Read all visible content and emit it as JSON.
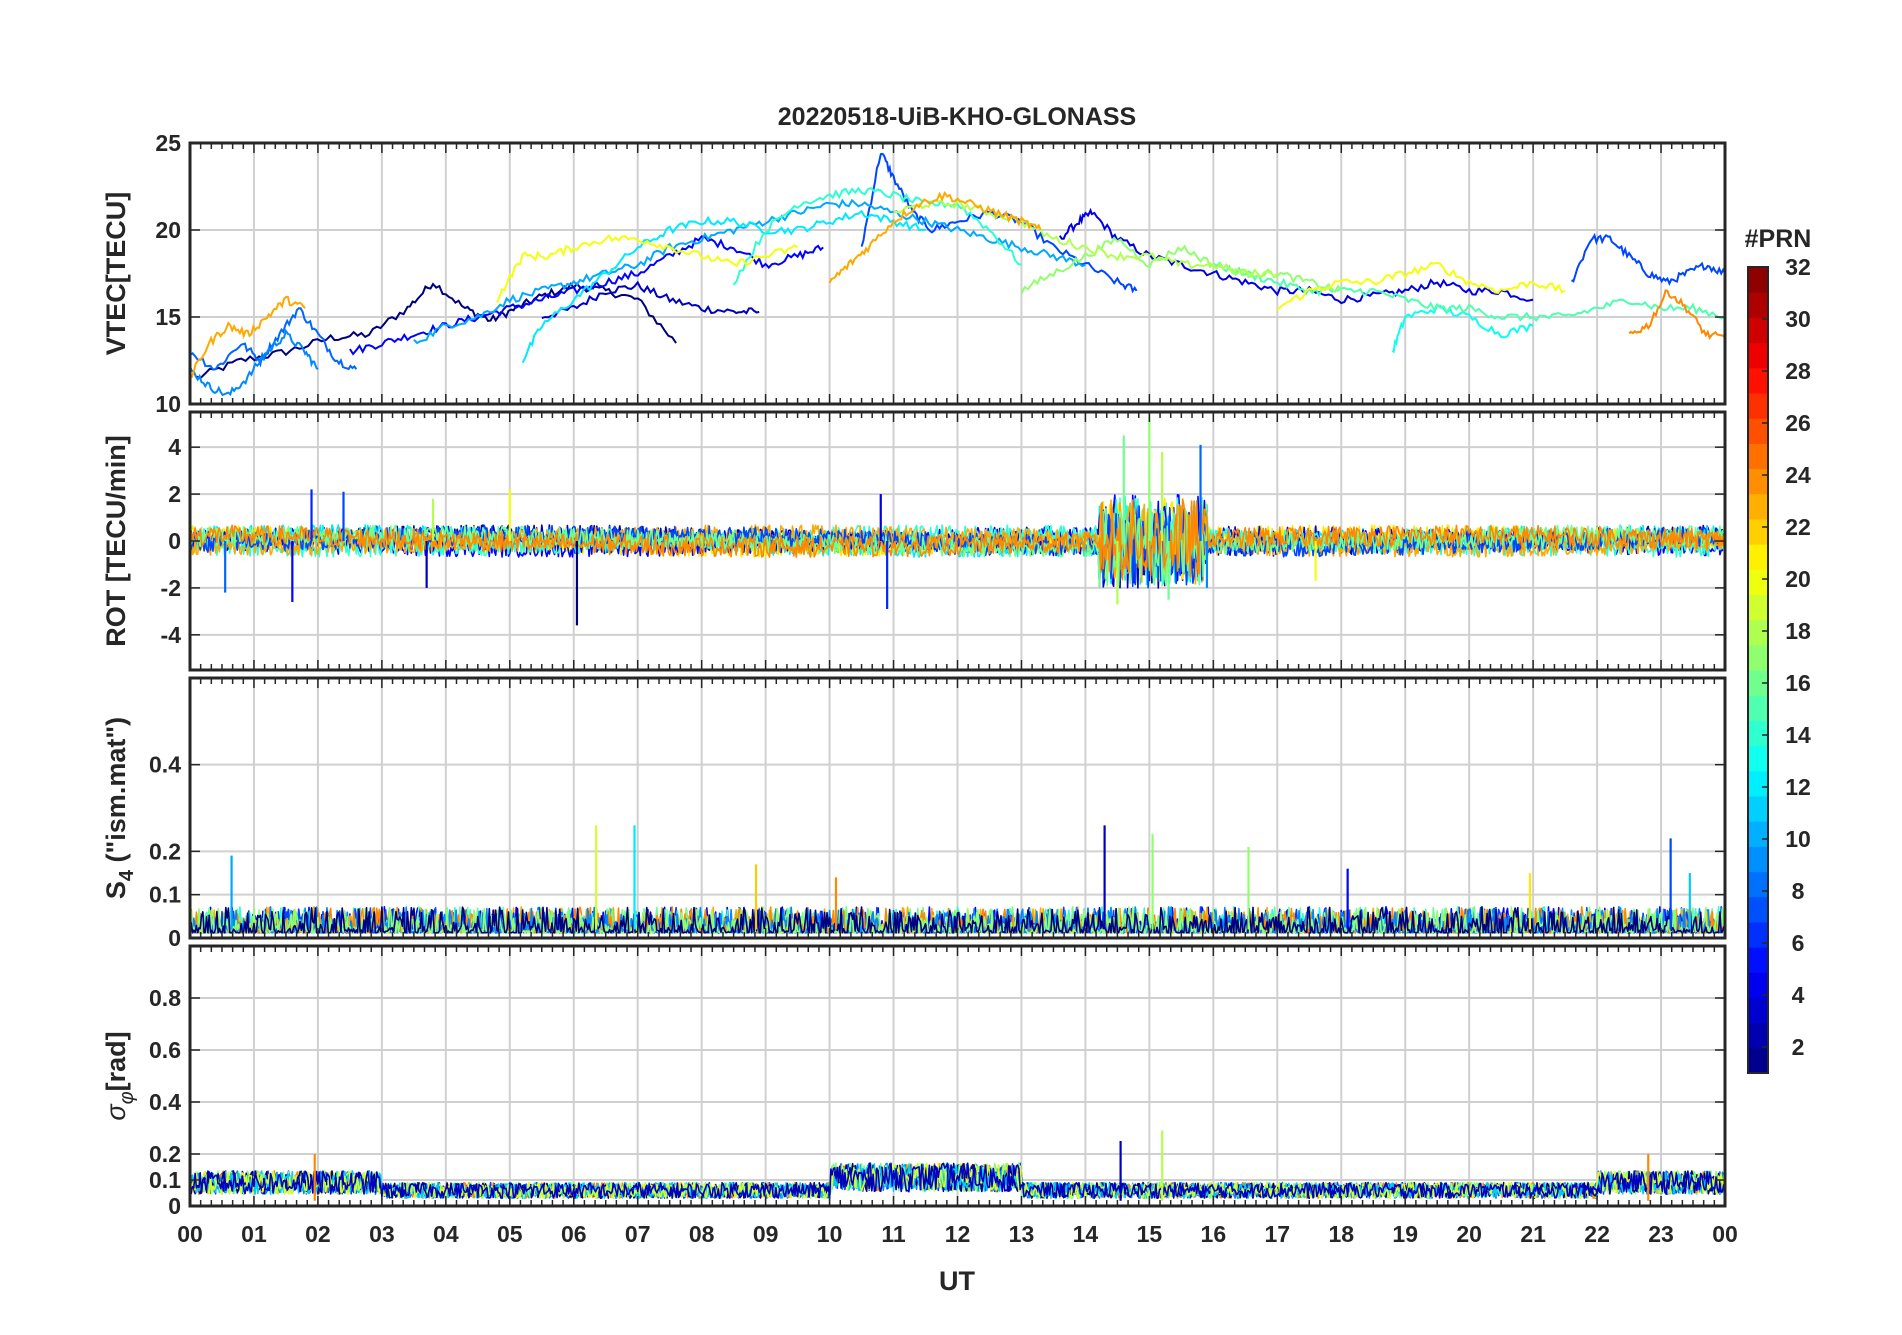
{
  "chart_data": {
    "type": "line",
    "title": "20220518-UiB-KHO-GLONASS",
    "xlabel": "UT",
    "x_tick_labels": [
      "00",
      "01",
      "02",
      "03",
      "04",
      "05",
      "06",
      "07",
      "08",
      "09",
      "10",
      "11",
      "12",
      "13",
      "14",
      "15",
      "16",
      "17",
      "18",
      "19",
      "20",
      "21",
      "22",
      "23",
      "00"
    ],
    "xlim": [
      0,
      24
    ],
    "grid": true,
    "colorbar": {
      "title": "#PRN",
      "range": [
        1,
        32
      ],
      "tick_labels": [
        "2",
        "4",
        "6",
        "8",
        "10",
        "12",
        "14",
        "16",
        "18",
        "20",
        "22",
        "24",
        "26",
        "28",
        "30",
        "32"
      ],
      "colormap": "jet"
    },
    "panels": [
      {
        "id": "vtec",
        "ylabel": "VTEC[TECU]",
        "ylim": [
          10,
          25
        ],
        "y_ticks": [
          10,
          15,
          20,
          25
        ],
        "y_tick_labels": [
          "10",
          "15",
          "20",
          "25"
        ],
        "series": [
          {
            "prn": 1,
            "x": [
              0.1,
              0.8,
              1.5,
              2.2,
              2.8,
              3.4,
              3.8,
              4.3,
              4.7,
              5.1,
              5.5,
              6.0,
              6.5,
              7.0,
              7.6
            ],
            "y": [
              11.5,
              12.5,
              13.0,
              13.8,
              14.0,
              15.5,
              17.0,
              15.5,
              14.8,
              15.5,
              16.2,
              16.8,
              16.5,
              16.0,
              13.5
            ]
          },
          {
            "prn": 3,
            "x": [
              5.5,
              6.0,
              6.5,
              7.0,
              7.5,
              8.0,
              8.5,
              8.9
            ],
            "y": [
              15.0,
              15.5,
              16.5,
              16.8,
              16.0,
              15.5,
              15.3,
              15.3
            ]
          },
          {
            "prn": 4,
            "x": [
              13.6,
              13.9,
              14.1,
              14.5,
              15.0,
              15.5,
              16.0,
              16.5,
              17.0,
              17.5,
              18.0,
              18.5,
              19.0,
              19.5,
              20.0,
              20.5,
              21.0
            ],
            "y": [
              19.5,
              20.5,
              21.0,
              19.5,
              18.5,
              18.0,
              17.5,
              17.0,
              16.5,
              16.5,
              16.0,
              16.2,
              16.5,
              17.0,
              16.5,
              16.5,
              16.0
            ]
          },
          {
            "prn": 5,
            "x": [
              2.5,
              3.0,
              3.5,
              4.0,
              4.5,
              5.0,
              5.5,
              6.0,
              6.5,
              7.0,
              7.5,
              8.0,
              8.5,
              9.0,
              9.5,
              9.9
            ],
            "y": [
              13.0,
              13.5,
              14.0,
              14.5,
              15.0,
              15.5,
              16.0,
              16.5,
              17.0,
              17.5,
              18.5,
              19.5,
              19.0,
              18.0,
              18.5,
              19.0
            ]
          },
          {
            "prn": 7,
            "x": [
              10.5,
              10.8,
              11.0,
              11.3,
              11.6,
              12.0,
              12.5,
              13.0,
              13.5,
              14.0,
              14.5,
              14.8
            ],
            "y": [
              19.0,
              24.5,
              23.0,
              21.0,
              20.0,
              20.5,
              21.0,
              20.5,
              19.0,
              18.0,
              17.0,
              16.5
            ]
          },
          {
            "prn": 7,
            "x": [
              21.6,
              21.9,
              22.2,
              22.5,
              22.8,
              23.1,
              23.4,
              23.7,
              24.0
            ],
            "y": [
              17.0,
              19.5,
              19.5,
              18.5,
              17.5,
              17.0,
              17.5,
              18.0,
              17.5
            ]
          },
          {
            "prn": 8,
            "x": [
              0.0,
              0.4,
              0.8,
              1.1,
              1.4,
              1.7,
              2.0,
              2.3,
              2.6
            ],
            "y": [
              13.0,
              12.0,
              13.5,
              12.5,
              14.0,
              15.5,
              14.0,
              12.5,
              12.0
            ]
          },
          {
            "prn": 9,
            "x": [
              0.0,
              0.3,
              0.6,
              0.9,
              1.2,
              1.5,
              1.8,
              2.0
            ],
            "y": [
              12.0,
              11.0,
              10.5,
              11.5,
              13.0,
              14.0,
              13.0,
              12.0
            ]
          },
          {
            "prn": 10,
            "x": [
              3.5,
              4.0,
              4.5,
              5.0,
              5.5,
              6.0,
              6.5,
              7.0,
              7.5,
              8.0,
              8.5,
              9.0,
              9.5,
              10.0,
              10.5,
              11.0,
              11.5,
              12.0,
              12.5,
              13.0,
              13.5,
              14.0
            ],
            "y": [
              13.5,
              14.5,
              15.0,
              16.0,
              16.5,
              17.0,
              17.5,
              18.0,
              19.0,
              19.5,
              20.0,
              20.5,
              21.0,
              21.5,
              21.5,
              21.0,
              20.5,
              20.0,
              19.5,
              19.0,
              18.5,
              18.0
            ]
          },
          {
            "prn": 12,
            "x": [
              5.2,
              5.5,
              6.0,
              6.5,
              7.0,
              7.5,
              8.0,
              8.5,
              9.0,
              9.5,
              10.0,
              10.5,
              11.0,
              11.5
            ],
            "y": [
              12.5,
              14.5,
              16.0,
              17.5,
              19.0,
              20.0,
              20.5,
              20.5,
              20.0,
              20.0,
              20.5,
              21.0,
              20.5,
              20.0
            ]
          },
          {
            "prn": 13,
            "x": [
              18.8,
              19.0,
              19.5,
              20.0,
              20.5,
              21.0
            ],
            "y": [
              13.0,
              15.0,
              15.5,
              15.0,
              14.0,
              14.5
            ]
          },
          {
            "prn": 14,
            "x": [
              8.5,
              9.0,
              9.5,
              10.0,
              10.5,
              11.0,
              11.5,
              12.0,
              12.5,
              13.0
            ],
            "y": [
              17.0,
              20.0,
              21.5,
              22.0,
              22.3,
              22.0,
              21.5,
              21.5,
              20.0,
              18.0
            ]
          },
          {
            "prn": 15,
            "x": [
              16.0,
              16.5,
              17.0,
              17.5,
              18.0,
              18.5,
              19.0,
              19.5,
              20.0,
              20.5,
              21.0,
              21.5,
              22.0,
              22.5,
              23.0,
              23.5,
              24.0
            ],
            "y": [
              18.0,
              17.5,
              17.0,
              16.5,
              16.5,
              16.5,
              16.0,
              15.5,
              15.5,
              15.0,
              15.0,
              15.0,
              15.5,
              16.0,
              15.5,
              15.5,
              15.0
            ]
          },
          {
            "prn": 17,
            "x": [
              13.0,
              13.5,
              14.0,
              14.5,
              15.0,
              15.5,
              16.0,
              16.5,
              17.0,
              17.5,
              18.0
            ],
            "y": [
              16.5,
              17.5,
              18.5,
              19.5,
              18.0,
              19.0,
              18.0,
              17.5,
              17.5,
              17.0,
              16.5
            ]
          },
          {
            "prn": 18,
            "x": [
              11.0,
              11.5,
              12.0,
              12.5,
              13.0,
              13.5,
              14.0,
              14.5,
              15.0,
              15.5,
              16.0,
              16.5,
              17.0
            ],
            "y": [
              21.0,
              21.5,
              21.5,
              21.0,
              20.5,
              19.5,
              19.0,
              18.5,
              18.5,
              18.0,
              18.0,
              17.5,
              17.5
            ]
          },
          {
            "prn": 20,
            "x": [
              4.8,
              5.2,
              5.6,
              6.0,
              6.5,
              7.0,
              7.5,
              8.0,
              8.5,
              9.0,
              9.5
            ],
            "y": [
              16.0,
              18.5,
              18.5,
              19.0,
              19.5,
              19.5,
              19.0,
              18.5,
              18.0,
              18.5,
              19.0
            ]
          },
          {
            "prn": 20,
            "x": [
              17.0,
              17.5,
              18.0,
              18.5,
              19.0,
              19.5,
              20.0,
              20.5,
              21.0,
              21.5
            ],
            "y": [
              15.5,
              16.5,
              17.0,
              17.0,
              17.5,
              18.0,
              17.0,
              16.5,
              17.0,
              16.5
            ]
          },
          {
            "prn": 23,
            "x": [
              0.0,
              0.3,
              0.6,
              0.9,
              1.2,
              1.5,
              1.8
            ],
            "y": [
              11.5,
              13.5,
              14.5,
              14.0,
              15.0,
              16.0,
              15.5
            ]
          },
          {
            "prn": 23,
            "x": [
              10.0,
              10.3,
              10.6,
              11.0,
              11.4,
              11.8,
              12.2,
              12.6,
              13.0,
              13.3
            ],
            "y": [
              17.0,
              18.0,
              19.0,
              20.5,
              21.5,
              22.0,
              21.5,
              21.0,
              20.5,
              20.0
            ]
          },
          {
            "prn": 24,
            "x": [
              22.5,
              22.8,
              23.1,
              23.4,
              23.7,
              24.0
            ],
            "y": [
              14.0,
              14.5,
              16.5,
              15.5,
              14.0,
              13.8
            ]
          }
        ]
      },
      {
        "id": "rot",
        "ylabel": "ROT [TECU/min]",
        "ylim": [
          -5.5,
          5.5
        ],
        "y_ticks": [
          -4,
          -2,
          0,
          2,
          4
        ],
        "y_tick_labels": [
          "-4",
          "-2",
          "0",
          "2",
          "4"
        ],
        "spikes": [
          {
            "prn": 8,
            "x": 0.55,
            "y": -2.2
          },
          {
            "prn": 5,
            "x": 1.6,
            "y": -2.6
          },
          {
            "prn": 6,
            "x": 1.9,
            "y": 2.2
          },
          {
            "prn": 7,
            "x": 2.4,
            "y": 2.1
          },
          {
            "prn": 3,
            "x": 3.7,
            "y": -2.0
          },
          {
            "prn": 18,
            "x": 3.8,
            "y": 1.8
          },
          {
            "prn": 20,
            "x": 5.0,
            "y": 2.2
          },
          {
            "prn": 1,
            "x": 6.05,
            "y": -3.6
          },
          {
            "prn": 4,
            "x": 10.8,
            "y": 2.0
          },
          {
            "prn": 6,
            "x": 10.9,
            "y": -2.9
          },
          {
            "prn": 16,
            "x": 14.6,
            "y": 4.5
          },
          {
            "prn": 18,
            "x": 14.5,
            "y": -2.7
          },
          {
            "prn": 17,
            "x": 15.0,
            "y": 5.3
          },
          {
            "prn": 16,
            "x": 15.3,
            "y": -2.5
          },
          {
            "prn": 18,
            "x": 15.2,
            "y": 3.8
          },
          {
            "prn": 8,
            "x": 15.8,
            "y": 4.1
          },
          {
            "prn": 9,
            "x": 15.9,
            "y": -2.0
          },
          {
            "prn": 20,
            "x": 17.6,
            "y": -1.7
          }
        ]
      },
      {
        "id": "s4",
        "ylabel": "S4 (\"ism.mat\")",
        "ylim": [
          0,
          0.6
        ],
        "y_ticks": [
          0,
          0.1,
          0.2,
          0.4
        ],
        "y_tick_labels": [
          "0",
          "0.1",
          "0.2",
          "0.4"
        ],
        "spikes": [
          {
            "prn": 10,
            "x": 0.65,
            "y": 0.19
          },
          {
            "prn": 19,
            "x": 6.35,
            "y": 0.26
          },
          {
            "prn": 12,
            "x": 6.95,
            "y": 0.26
          },
          {
            "prn": 22,
            "x": 8.85,
            "y": 0.17
          },
          {
            "prn": 24,
            "x": 10.1,
            "y": 0.14
          },
          {
            "prn": 3,
            "x": 14.3,
            "y": 0.26
          },
          {
            "prn": 17,
            "x": 15.05,
            "y": 0.24
          },
          {
            "prn": 17,
            "x": 16.55,
            "y": 0.21
          },
          {
            "prn": 5,
            "x": 18.1,
            "y": 0.16
          },
          {
            "prn": 21,
            "x": 20.95,
            "y": 0.15
          },
          {
            "prn": 7,
            "x": 23.15,
            "y": 0.23
          },
          {
            "prn": 11,
            "x": 23.45,
            "y": 0.15
          }
        ]
      },
      {
        "id": "sigma_phi",
        "ylabel": "σφ[rad]",
        "ylim": [
          0,
          1.0
        ],
        "y_ticks": [
          0,
          0.1,
          0.2,
          0.4,
          0.6,
          0.8
        ],
        "y_tick_labels": [
          "0",
          "0.1",
          "0.2",
          "0.4",
          "0.6",
          "0.8"
        ],
        "spikes": [
          {
            "prn": 3,
            "x": 14.55,
            "y": 0.25
          },
          {
            "prn": 18,
            "x": 15.2,
            "y": 0.29
          },
          {
            "prn": 24,
            "x": 1.95,
            "y": 0.2
          },
          {
            "prn": 24,
            "x": 22.8,
            "y": 0.2
          }
        ]
      }
    ]
  }
}
